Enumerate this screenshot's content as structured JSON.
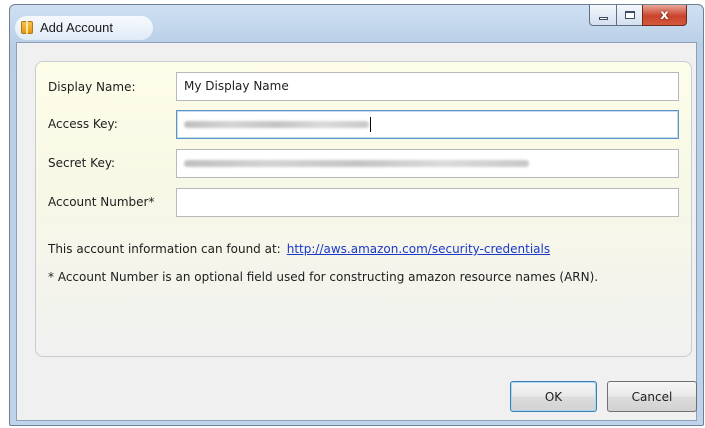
{
  "window": {
    "title": "Add Account",
    "close_glyph": "x",
    "icon": "package-icon"
  },
  "form": {
    "display_name": {
      "label": "Display Name:",
      "value": "My Display Name"
    },
    "access_key": {
      "label": "Access Key:",
      "value": "",
      "obscured": true
    },
    "secret_key": {
      "label": "Secret Key:",
      "value": "",
      "obscured": true
    },
    "account_number": {
      "label": "Account Number*",
      "value": ""
    }
  },
  "info": {
    "text": "This account information can found at:",
    "link": "http://aws.amazon.com/security-credentials"
  },
  "note": "* Account Number is an optional field used for constructing amazon resource names (ARN).",
  "buttons": {
    "ok": "OK",
    "cancel": "Cancel"
  },
  "colors": {
    "link": "#1a39c9",
    "panel_bg": "#fdfdea",
    "close_button": "#c9442b"
  }
}
